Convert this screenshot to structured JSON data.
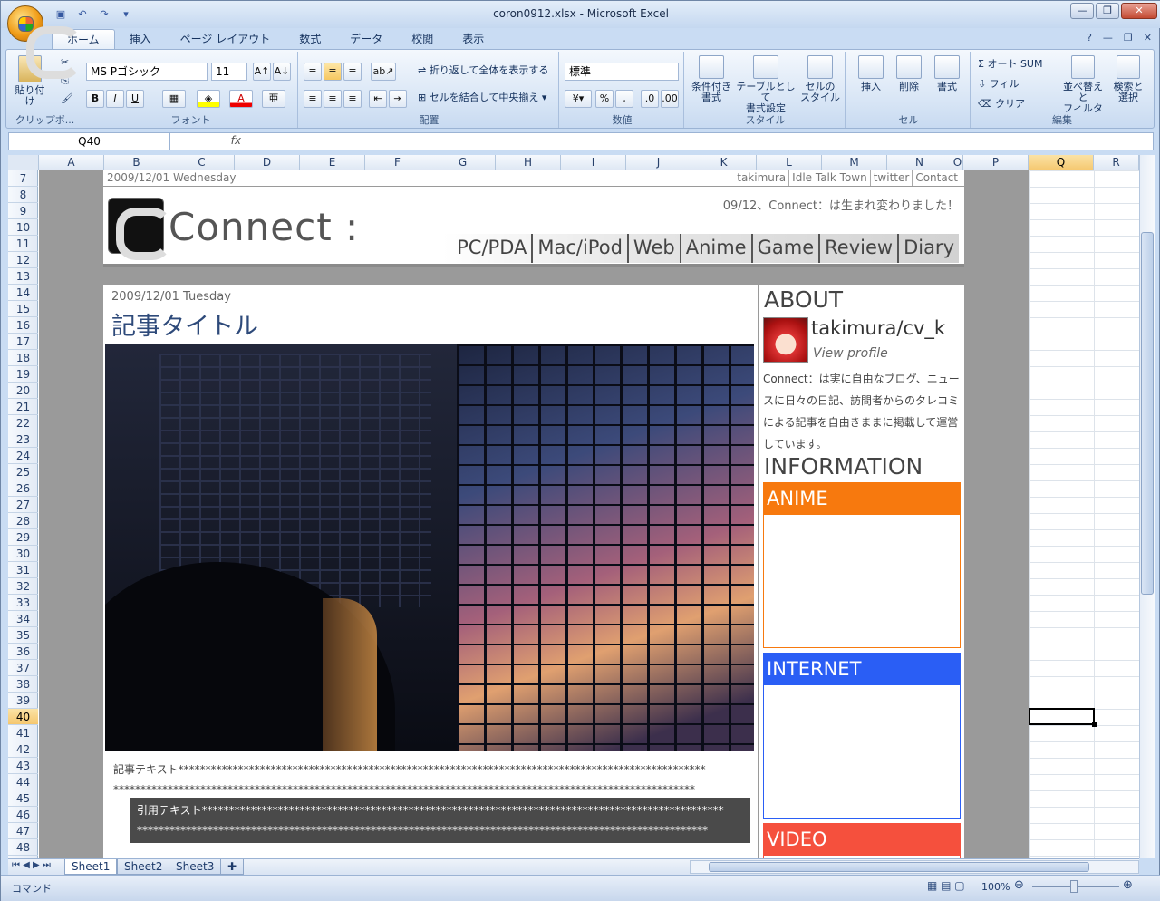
{
  "window": {
    "title": "coron0912.xlsx - Microsoft Excel"
  },
  "ribbon_tabs": [
    "ホーム",
    "挿入",
    "ページ レイアウト",
    "数式",
    "データ",
    "校閲",
    "表示"
  ],
  "clipboard": {
    "paste": "貼り付け",
    "group": "クリップボ..."
  },
  "font": {
    "name": "MS Pゴシック",
    "size": "11",
    "bold": "B",
    "italic": "I",
    "underline": "U",
    "group": "フォント"
  },
  "alignment": {
    "wrap": "折り返して全体を表示する",
    "merge": "セルを結合して中央揃え",
    "group": "配置"
  },
  "number": {
    "format": "標準",
    "percent": "%",
    "comma": ",",
    "group": "数値"
  },
  "styles": {
    "conditional": "条件付き\n書式",
    "table": "テーブルとして\n書式設定",
    "cell": "セルの\nスタイル",
    "group": "スタイル"
  },
  "cells": {
    "insert": "挿入",
    "delete": "削除",
    "format": "書式",
    "group": "セル"
  },
  "editing": {
    "autosum": "Σ オート SUM",
    "fill": "フィル",
    "clear": "クリア",
    "sort": "並べ替えと\nフィルタ",
    "find": "検索と\n選択",
    "group": "編集"
  },
  "formula_bar": {
    "name_box": "Q40",
    "fx": "fx"
  },
  "columns": [
    "A",
    "B",
    "C",
    "D",
    "E",
    "F",
    "G",
    "H",
    "I",
    "J",
    "K",
    "L",
    "M",
    "N",
    "O",
    "P",
    "Q",
    "R"
  ],
  "selected_column": "Q",
  "rows": [
    "7",
    "8",
    "9",
    "10",
    "11",
    "12",
    "13",
    "14",
    "15",
    "16",
    "17",
    "18",
    "19",
    "20",
    "21",
    "22",
    "23",
    "24",
    "25",
    "26",
    "27",
    "28",
    "29",
    "30",
    "31",
    "32",
    "33",
    "34",
    "35",
    "36",
    "37",
    "38",
    "39",
    "40",
    "41",
    "42",
    "43",
    "44",
    "45",
    "46",
    "47",
    "48"
  ],
  "selected_row": "40",
  "blog": {
    "top_date": "2009/12/01 Wednesday",
    "top_links": [
      "takimura",
      "Idle Talk Town",
      "twitter",
      "Contact"
    ],
    "brand": "Connect :",
    "tagline": "09/12、Connect：は生まれ変わりました！",
    "nav": [
      "PC/PDA",
      "Mac/iPod",
      "Web",
      "Anime",
      "Game",
      "Review",
      "Diary"
    ],
    "post_date": "2009/12/01 Tuesday",
    "post_title": "記事タイトル",
    "body_line1": "記事テキスト*************************************************************************************************",
    "body_line2": "***********************************************************************************************************",
    "quote_line1": "引用テキスト************************************************************************************************",
    "quote_line2": "*********************************************************************************************************",
    "about_heading": "ABOUT",
    "username": "takimura/cv_k",
    "view_profile": "View profile",
    "bio": "Connect：は実に自由なブログ、ニュースに日々の日記、訪問者からのタレコミによる記事を自由きままに掲載して運営しています。",
    "info_heading": "INFORMATION",
    "boxes": [
      {
        "label": "ANIME",
        "color": "#f7790e"
      },
      {
        "label": "INTERNET",
        "color": "#2a5ef5"
      },
      {
        "label": "VIDEO",
        "color": "#f5503d"
      }
    ]
  },
  "sheets": [
    "Sheet1",
    "Sheet2",
    "Sheet3"
  ],
  "status": {
    "mode": "コマンド",
    "zoom": "100%"
  }
}
